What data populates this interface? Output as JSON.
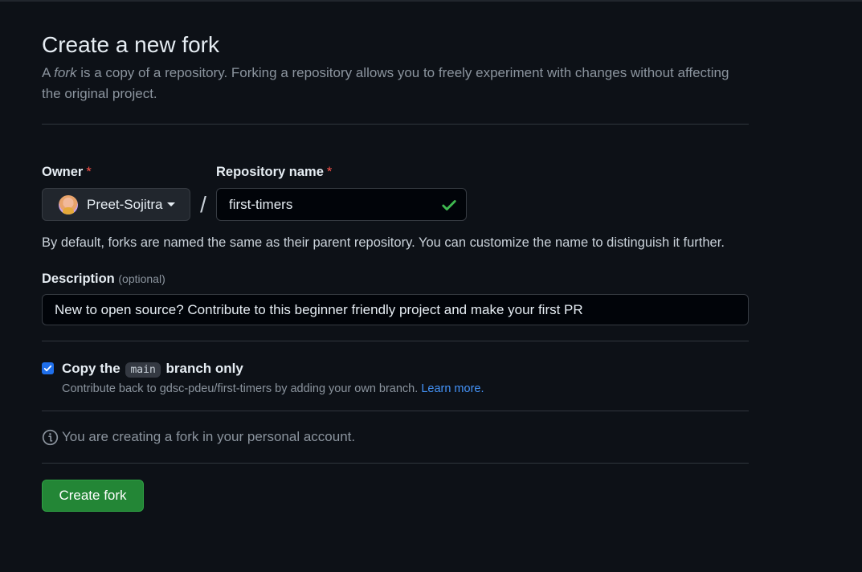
{
  "page": {
    "title": "Create a new fork",
    "subtitle_prefix": "A ",
    "subtitle_em": "fork",
    "subtitle_rest": " is a copy of a repository. Forking a repository allows you to freely experiment with changes without affecting the original project."
  },
  "owner": {
    "label": "Owner",
    "required_mark": "*",
    "value": "Preet-Sojitra"
  },
  "separator": "/",
  "repository": {
    "label": "Repository name",
    "required_mark": "*",
    "value": "first-timers",
    "valid_icon": "check-icon"
  },
  "naming_help": "By default, forks are named the same as their parent repository. You can customize the name to distinguish it further.",
  "description": {
    "label": "Description",
    "optional": "(optional)",
    "value": "New to open source? Contribute to this beginner friendly project and make your first PR"
  },
  "copy_branch": {
    "checked": true,
    "label_prefix": "Copy the",
    "branch": "main",
    "label_suffix": "branch only",
    "sub_text": "Contribute back to gdsc-pdeu/first-timers by adding your own branch.",
    "learn_more": "Learn more."
  },
  "info": {
    "icon": "info-icon",
    "text": "You are creating a fork in your personal account."
  },
  "actions": {
    "create_label": "Create fork"
  },
  "colors": {
    "background": "#0d1117",
    "primary_button": "#238636",
    "link": "#4493f8",
    "required": "#f85149",
    "checkbox": "#1f6feb"
  }
}
